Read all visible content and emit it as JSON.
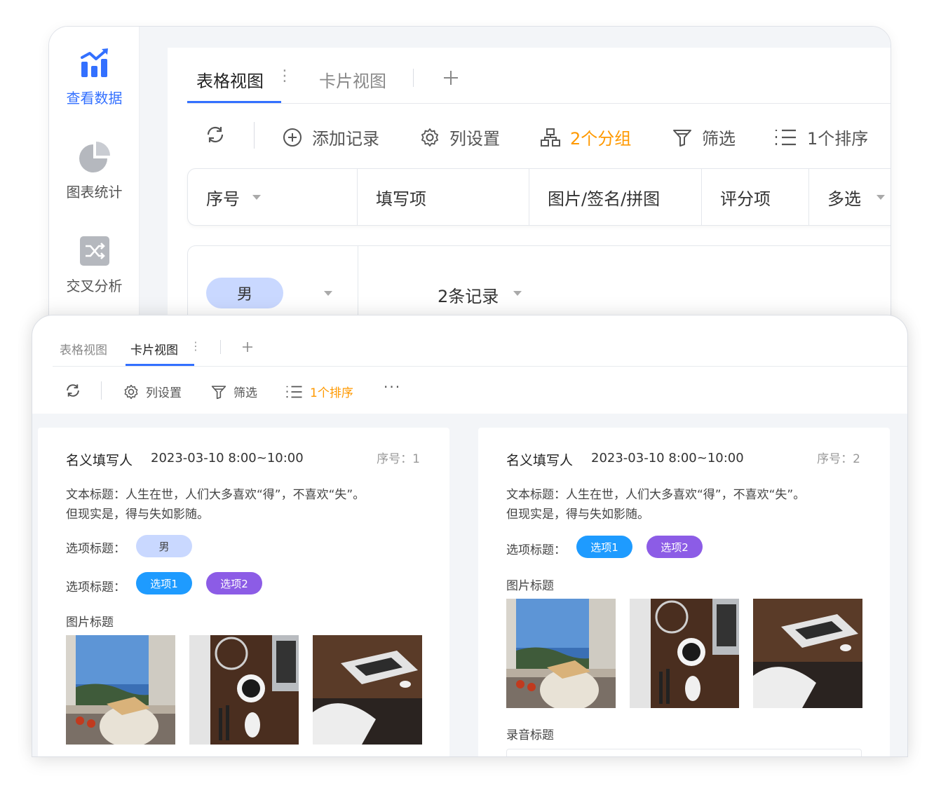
{
  "sidebar": {
    "items": [
      {
        "label": "查看数据",
        "icon": "bar-chart-icon",
        "active": true
      },
      {
        "label": "图表统计",
        "icon": "pie-chart-icon",
        "active": false
      },
      {
        "label": "交叉分析",
        "icon": "shuffle-icon",
        "active": false
      }
    ]
  },
  "back": {
    "tabs": [
      {
        "label": "表格视图"
      },
      {
        "label": "卡片视图"
      }
    ],
    "toolbar": {
      "add_record": "添加记录",
      "column_settings": "列设置",
      "group": "2个分组",
      "filter": "筛选",
      "sort": "1个排序"
    },
    "columns": [
      "序号",
      "填写项",
      "图片/签名/拼图",
      "评分项",
      "多选"
    ],
    "group_row": {
      "tag": "男",
      "records": "2条记录"
    }
  },
  "front": {
    "tabs": [
      {
        "label": "表格视图"
      },
      {
        "label": "卡片视图"
      }
    ],
    "toolbar": {
      "column_settings": "列设置",
      "filter": "筛选",
      "sort": "1个排序",
      "more": "···"
    },
    "cards": [
      {
        "name": "名义填写人",
        "time": "2023-03-10 8:00~10:00",
        "seq": "序号：1",
        "text_line1": "文本标题：人生在世，人们大多喜欢“得”，不喜欢“失”。",
        "text_line2": "但现实是，得与失如影随。",
        "option_label1": "选项标题：",
        "option_tag1": "男",
        "option_label2": "选项标题：",
        "option_tag2a": "选项1",
        "option_tag2b": "选项2",
        "image_label": "图片标题"
      },
      {
        "name": "名义填写人",
        "time": "2023-03-10 8:00~10:00",
        "seq": "序号：2",
        "text_line1": "文本标题：人生在世，人们大多喜欢“得”，不喜欢“失”。",
        "text_line2": "但现实是，得与失如影随。",
        "option_label1": "选项标题：",
        "option_tag2a": "选项1",
        "option_tag2b": "选项2",
        "image_label": "图片标题",
        "audio_label": "录音标题"
      }
    ]
  },
  "colors": {
    "accent": "#3370ff",
    "orange": "#ff9900",
    "tag_blue": "#1e9bff",
    "tag_purple": "#8c5ce6",
    "tag_male": "#c9d8ff"
  }
}
